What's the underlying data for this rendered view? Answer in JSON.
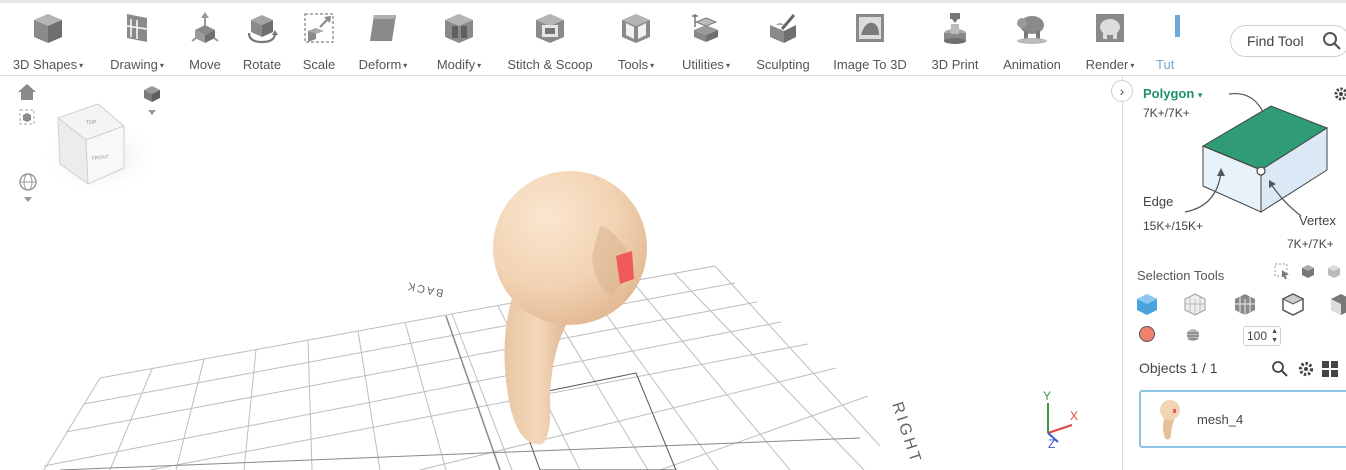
{
  "toolbar": {
    "items": [
      {
        "label": "3D Shapes",
        "dropdown": true,
        "icon": "cube-icon"
      },
      {
        "label": "Drawing",
        "dropdown": true,
        "icon": "drawing-icon"
      },
      {
        "label": "Move",
        "dropdown": false,
        "icon": "move-icon"
      },
      {
        "label": "Rotate",
        "dropdown": false,
        "icon": "rotate-icon"
      },
      {
        "label": "Scale",
        "dropdown": false,
        "icon": "scale-icon"
      },
      {
        "label": "Deform",
        "dropdown": true,
        "icon": "deform-icon"
      },
      {
        "label": "Modify",
        "dropdown": true,
        "icon": "modify-icon"
      },
      {
        "label": "Stitch & Scoop",
        "dropdown": false,
        "icon": "stitch-scoop-icon"
      },
      {
        "label": "Tools",
        "dropdown": true,
        "icon": "tools-icon"
      },
      {
        "label": "Utilities",
        "dropdown": true,
        "icon": "utilities-icon"
      },
      {
        "label": "Sculpting",
        "dropdown": false,
        "icon": "sculpting-icon"
      },
      {
        "label": "Image To 3D",
        "dropdown": false,
        "icon": "image-to-3d-icon"
      },
      {
        "label": "3D Print",
        "dropdown": false,
        "icon": "3d-print-icon"
      },
      {
        "label": "Animation",
        "dropdown": false,
        "icon": "animation-icon"
      },
      {
        "label": "Render",
        "dropdown": true,
        "icon": "render-icon"
      },
      {
        "label": "Tut",
        "dropdown": false,
        "icon": "tutorials-icon"
      }
    ],
    "caret": "▾",
    "find_tool_placeholder": "Find Tool"
  },
  "viewport": {
    "view_cube": {
      "front_label": "FRONT",
      "top_label": "TOP"
    },
    "floor_labels": {
      "back": "BACK",
      "right": "RIGHT"
    },
    "axes": {
      "y": "Y",
      "x": "X",
      "z": "Z"
    },
    "object_color": "#f2d3b3"
  },
  "panel": {
    "selection_mode": "Polygon",
    "polygon_count": "7K+/7K+",
    "edge_label": "Edge",
    "edge_count": "15K+/15K+",
    "vertex_label": "Vertex",
    "vertex_count": "7K+/7K+",
    "selection_tools_title": "Selection Tools",
    "brush_value": "100",
    "objects_title": "Objects 1 / 1",
    "objects": [
      {
        "name": "mesh_4"
      }
    ],
    "accent_color": "#1e8f6f",
    "selected_border": "#8ec3e8",
    "brush_color": "#f08070"
  }
}
